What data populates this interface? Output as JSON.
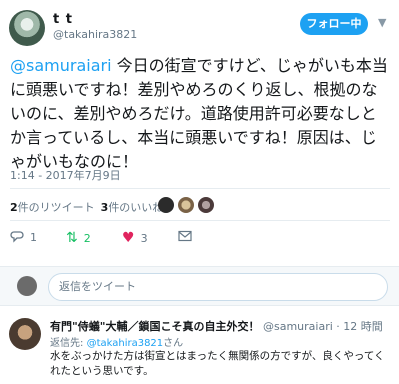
{
  "author": {
    "display_name": "t t",
    "handle": "@takahira3821"
  },
  "follow_button": {
    "label": "フォロー中"
  },
  "tweet": {
    "mention": "@samuraiari",
    "text": " 今日の街宣ですけど、じゃがいも本当に頭悪いですね！差別やめろのくり返し、根拠のないのに、差別やめろだけ。道路使用許可必要なしとか言っているし、本当に頭悪いですね！原因は、じゃがいもなのに！",
    "timestamp": "1:14 - 2017年7月9日"
  },
  "stats": {
    "retweets_count": "2",
    "retweets_label": "件のリツイート",
    "likes_count": "3",
    "likes_label": "件のいいね"
  },
  "actions": {
    "reply_count": "1",
    "retweet_count": "2",
    "like_count": "3",
    "reply_icon": "reply-icon",
    "retweet_icon": "retweet-icon",
    "like_icon": "heart-icon",
    "dm_icon": "envelope-icon"
  },
  "compose": {
    "placeholder": "返信をツイート"
  },
  "reply": {
    "name": "有門\"侍蟻\"大輔／鎖国こそ真の自主外交！",
    "handle": "@samuraiari",
    "time": "· 12 時間",
    "reply_prefix": "返信先: ",
    "reply_to": "@takahira3821",
    "reply_suffix": "さん",
    "text": "水をぶっかけた方は街宣とはまったく無関係の方ですが、良くやってくれたという思いです。"
  },
  "colors": {
    "accent": "#1da1f2",
    "like": "#e0245e",
    "retweet": "#17bf63"
  }
}
